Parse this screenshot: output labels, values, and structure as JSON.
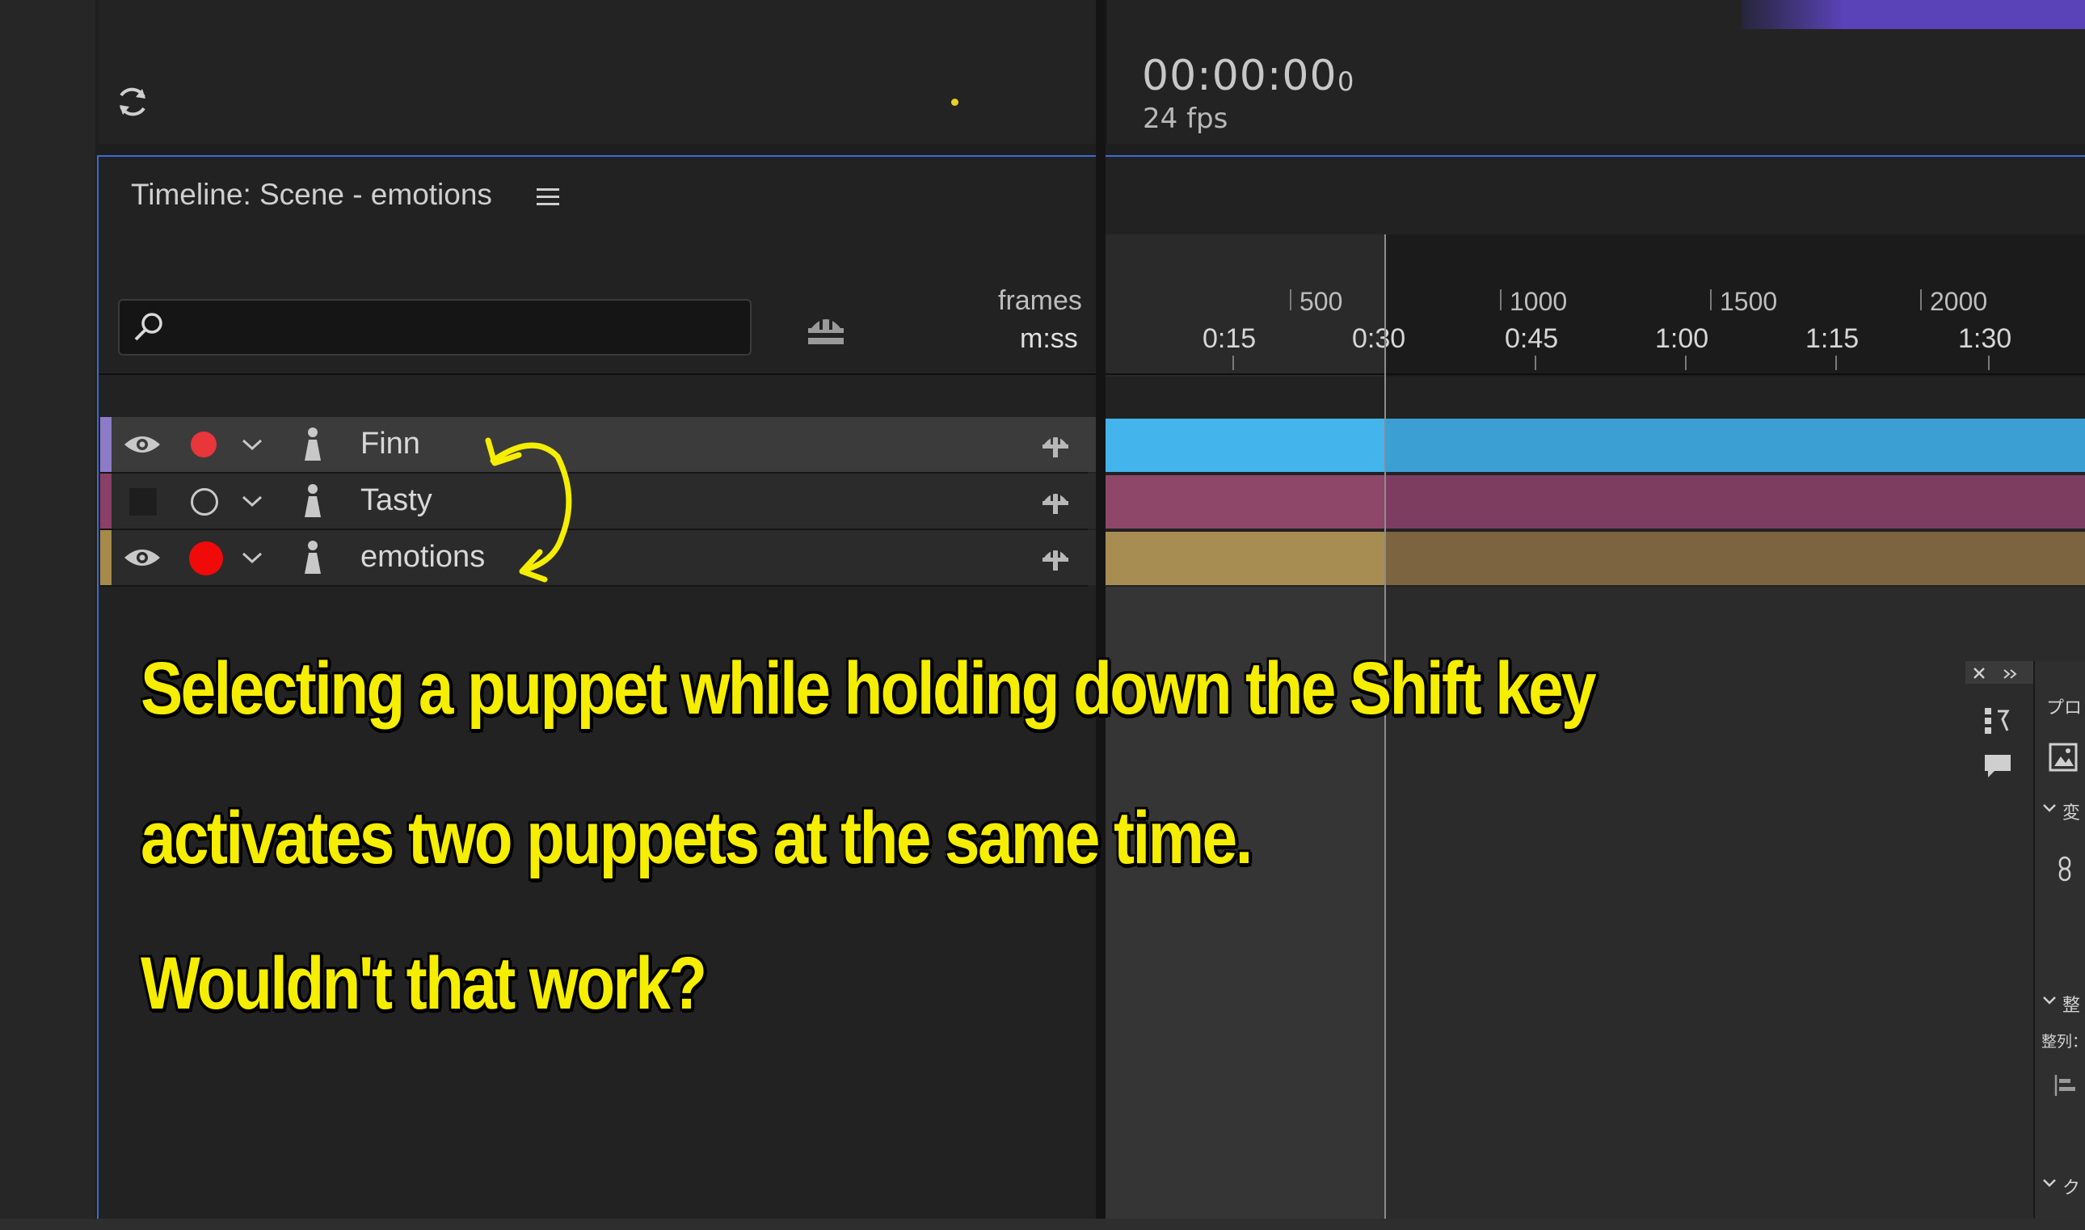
{
  "header": {
    "timecode": "00:00:00",
    "timecode_frames": "0",
    "fps": "24 fps"
  },
  "timeline": {
    "title": "Timeline: Scene - emotions",
    "search_placeholder": "",
    "ruler": {
      "frames_label": "frames",
      "mss_label": "m:ss",
      "frame_ticks": [
        "500",
        "1000",
        "1500",
        "2000"
      ],
      "time_ticks": [
        "0:15",
        "0:30",
        "0:45",
        "1:00",
        "1:15",
        "1:30"
      ]
    },
    "layers": [
      {
        "name": "Finn",
        "color": "#8e7bc8",
        "bar_color": "#3b9fd4",
        "visible": true,
        "armed": true
      },
      {
        "name": "Tasty",
        "color": "#8a3f66",
        "bar_color": "#7d3d61",
        "visible": false,
        "armed": false
      },
      {
        "name": "emotions",
        "color": "#a68a4a",
        "bar_color": "#7d6440",
        "visible": true,
        "armed": true
      }
    ]
  },
  "annotation": {
    "line1": "Selecting a puppet while holding down the Shift key",
    "line2": "activates two puppets at the same time.",
    "line3": "Wouldn't that work?",
    "color": "#f6ee00"
  },
  "right_panel": {
    "tab_label": "プロ",
    "section1": "変",
    "section2": "整",
    "section2_sub": "整列：",
    "section3": "ク"
  }
}
